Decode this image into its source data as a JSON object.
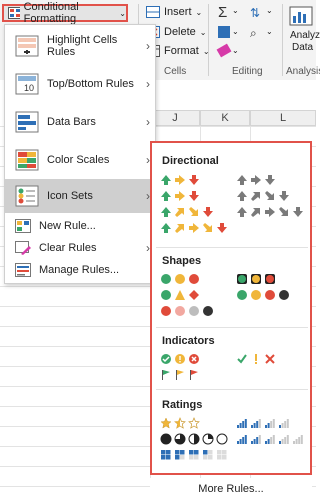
{
  "ribbon": {
    "conditional_formatting": "Conditional Formatting",
    "insert": "Insert",
    "delete": "Delete",
    "format": "Format",
    "cells": "Cells",
    "editing": "Editing",
    "analyze_line1": "Analyz",
    "analyze_line2": "Data",
    "analysis": "Analysis"
  },
  "grid": {
    "columns": [
      "J",
      "K",
      "L"
    ]
  },
  "menu": {
    "items": [
      {
        "label": "Highlight Cells Rules",
        "underline": "H"
      },
      {
        "label": "Top/Bottom Rules",
        "underline": "T"
      },
      {
        "label": "Data Bars",
        "underline": "D"
      },
      {
        "label": "Color Scales",
        "underline": "S"
      },
      {
        "label": "Icon Sets",
        "underline": "I"
      }
    ],
    "new_rule": "New Rule...",
    "clear_rules": "Clear Rules",
    "manage_rules": "Manage Rules..."
  },
  "submenu": {
    "sections": [
      "Directional",
      "Shapes",
      "Indicators",
      "Ratings"
    ],
    "more_rules": "More Rules..."
  },
  "colors": {
    "green": "#3aa66a",
    "yellow": "#f0b63a",
    "red": "#e04b3a",
    "gray": "#7a7a7a",
    "blue": "#2e6fb6",
    "highlight_border": "#e1524a"
  }
}
